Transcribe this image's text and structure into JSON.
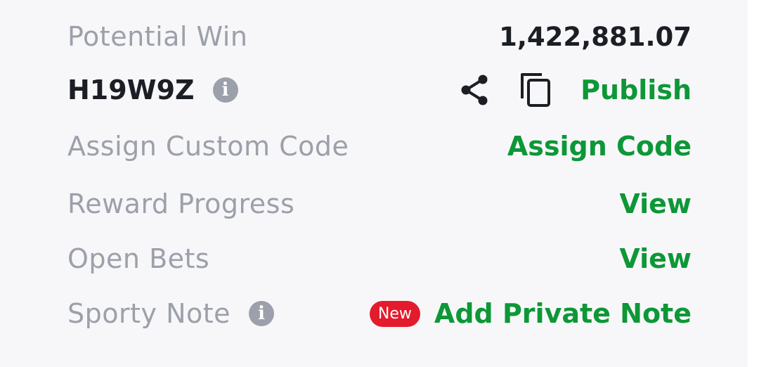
{
  "rows": {
    "potential_win": {
      "label": "Potential Win",
      "value": "1,422,881.07"
    },
    "booking": {
      "code": "H19W9Z",
      "info_icon": "info-icon",
      "share_icon": "share-icon",
      "copy_icon": "copy-icon",
      "action": "Publish"
    },
    "custom_code": {
      "label": "Assign Custom Code",
      "action": "Assign Code"
    },
    "reward_progress": {
      "label": "Reward Progress",
      "action": "View"
    },
    "open_bets": {
      "label": "Open Bets",
      "action": "View"
    },
    "sporty_note": {
      "label": "Sporty Note",
      "info_icon": "info-icon",
      "badge": "New",
      "action": "Add Private Note"
    }
  },
  "colors": {
    "accent_green": "#0d9737",
    "label_grey": "#9ca0aa",
    "text_dark": "#1b1e24",
    "badge_red": "#e41b2c",
    "panel_bg": "#f7f7f9"
  }
}
